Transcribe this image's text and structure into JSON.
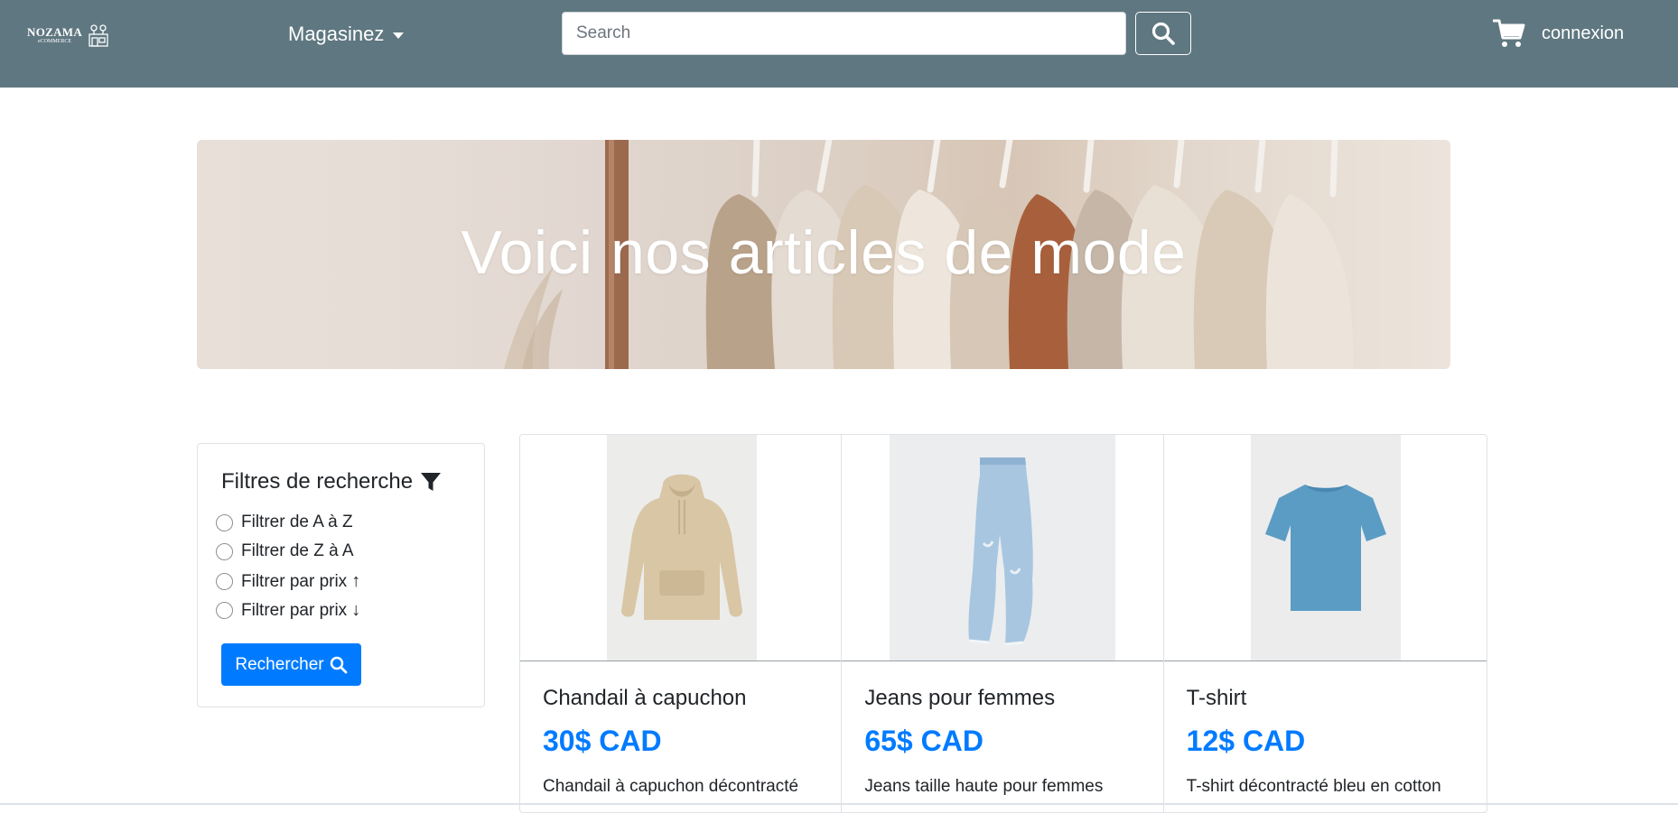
{
  "brand": {
    "name": "NOZAMA",
    "tagline": "eCOMMERCE"
  },
  "nav": {
    "shop_label": "Magasinez",
    "search_placeholder": "Search",
    "login_label": "connexion"
  },
  "hero": {
    "title": "Voici nos articles de mode"
  },
  "filters": {
    "title": "Filtres de recherche",
    "options": [
      {
        "label": "Filtrer de A à Z",
        "arrow": ""
      },
      {
        "label": "Filtrer de Z à A",
        "arrow": ""
      },
      {
        "label": "Filtrer par prix",
        "arrow": "↑"
      },
      {
        "label": "Filtrer par prix",
        "arrow": "↓"
      }
    ],
    "submit_label": "Rechercher"
  },
  "products": [
    {
      "title": "Chandail à capuchon",
      "price": "30$ CAD",
      "description": "Chandail à capuchon décontracté",
      "image": "beige-hoodie"
    },
    {
      "title": "Jeans pour femmes",
      "price": "65$ CAD",
      "description": "Jeans taille haute pour femmes",
      "image": "light-blue-jeans"
    },
    {
      "title": "T-shirt",
      "price": "12$ CAD",
      "description": "T-shirt décontracté bleu en cotton",
      "image": "blue-tshirt"
    }
  ],
  "colors": {
    "navbar": "#5f7780",
    "accent": "#007bff",
    "price": "#007bff"
  }
}
